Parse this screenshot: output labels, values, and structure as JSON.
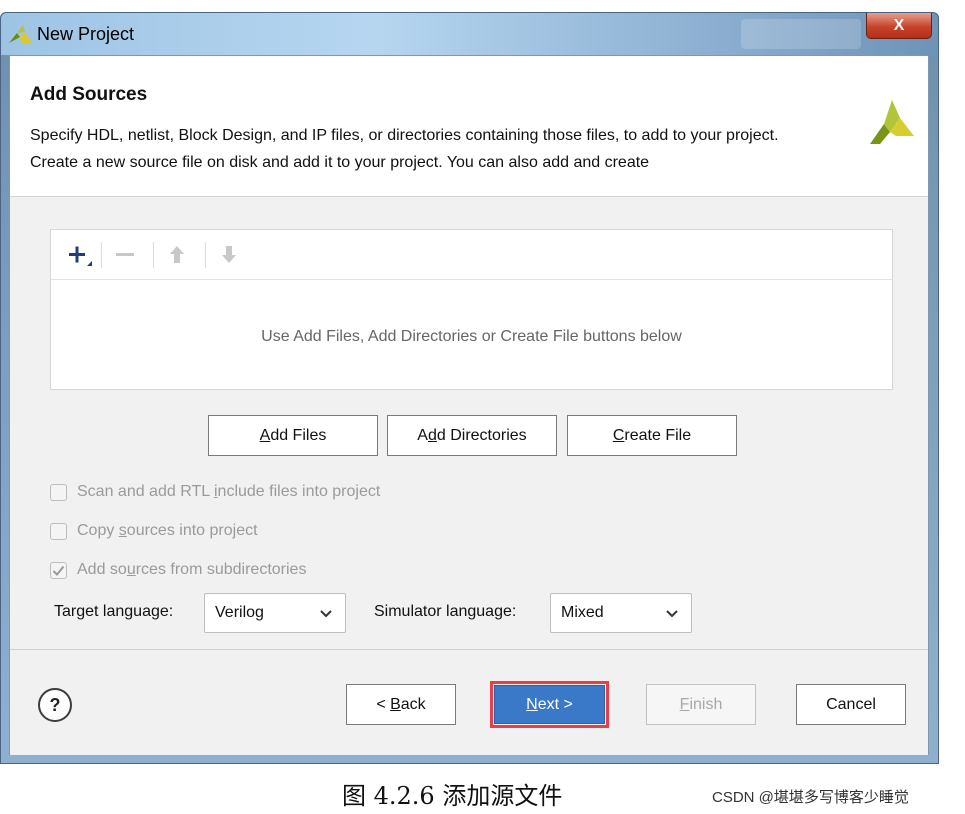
{
  "window": {
    "title": "New Project",
    "close_label": "X"
  },
  "header": {
    "title": "Add Sources",
    "description": "Specify HDL, netlist, Block Design, and IP files, or directories containing those files, to add to your project. Create a new source file on disk and add it to your project. You can also add and create"
  },
  "sources_panel": {
    "toolbar_icons": [
      "add-icon",
      "remove-icon",
      "move-up-icon",
      "move-down-icon"
    ],
    "empty_message": "Use Add Files, Add Directories or Create File buttons below"
  },
  "actions": {
    "add_files": {
      "pre": "",
      "key": "A",
      "post": "dd Files"
    },
    "add_directories": {
      "pre": "A",
      "key": "d",
      "post": "d Directories"
    },
    "create_file": {
      "pre": "",
      "key": "C",
      "post": "reate File"
    }
  },
  "options": {
    "scan_rtl": {
      "pre": "Scan and add RTL ",
      "key": "i",
      "post": "nclude files into project",
      "checked": false
    },
    "copy_sources": {
      "pre": "Copy ",
      "key": "s",
      "post": "ources into project",
      "checked": false
    },
    "add_subdirs": {
      "pre": "Add so",
      "key": "u",
      "post": "rces from subdirectories",
      "checked": true
    }
  },
  "languages": {
    "target_label": "Target language:",
    "target_value": "Verilog",
    "simulator_label": "Simulator language:",
    "simulator_value": "Mixed"
  },
  "footer": {
    "help_label": "?",
    "back": {
      "pre": "< ",
      "key": "B",
      "post": "ack"
    },
    "next": {
      "pre": "",
      "key": "N",
      "post": "ext >"
    },
    "finish": {
      "pre": "",
      "key": "F",
      "post": "inish"
    },
    "cancel": "Cancel"
  },
  "caption": {
    "text": "图  4.2.6  添加源文件",
    "watermark": "CSDN @堪堪多写博客少睡觉"
  },
  "colors": {
    "accent_next": "#3a78c8",
    "highlight_border": "#e8404a",
    "logo": "#9aad1e"
  }
}
